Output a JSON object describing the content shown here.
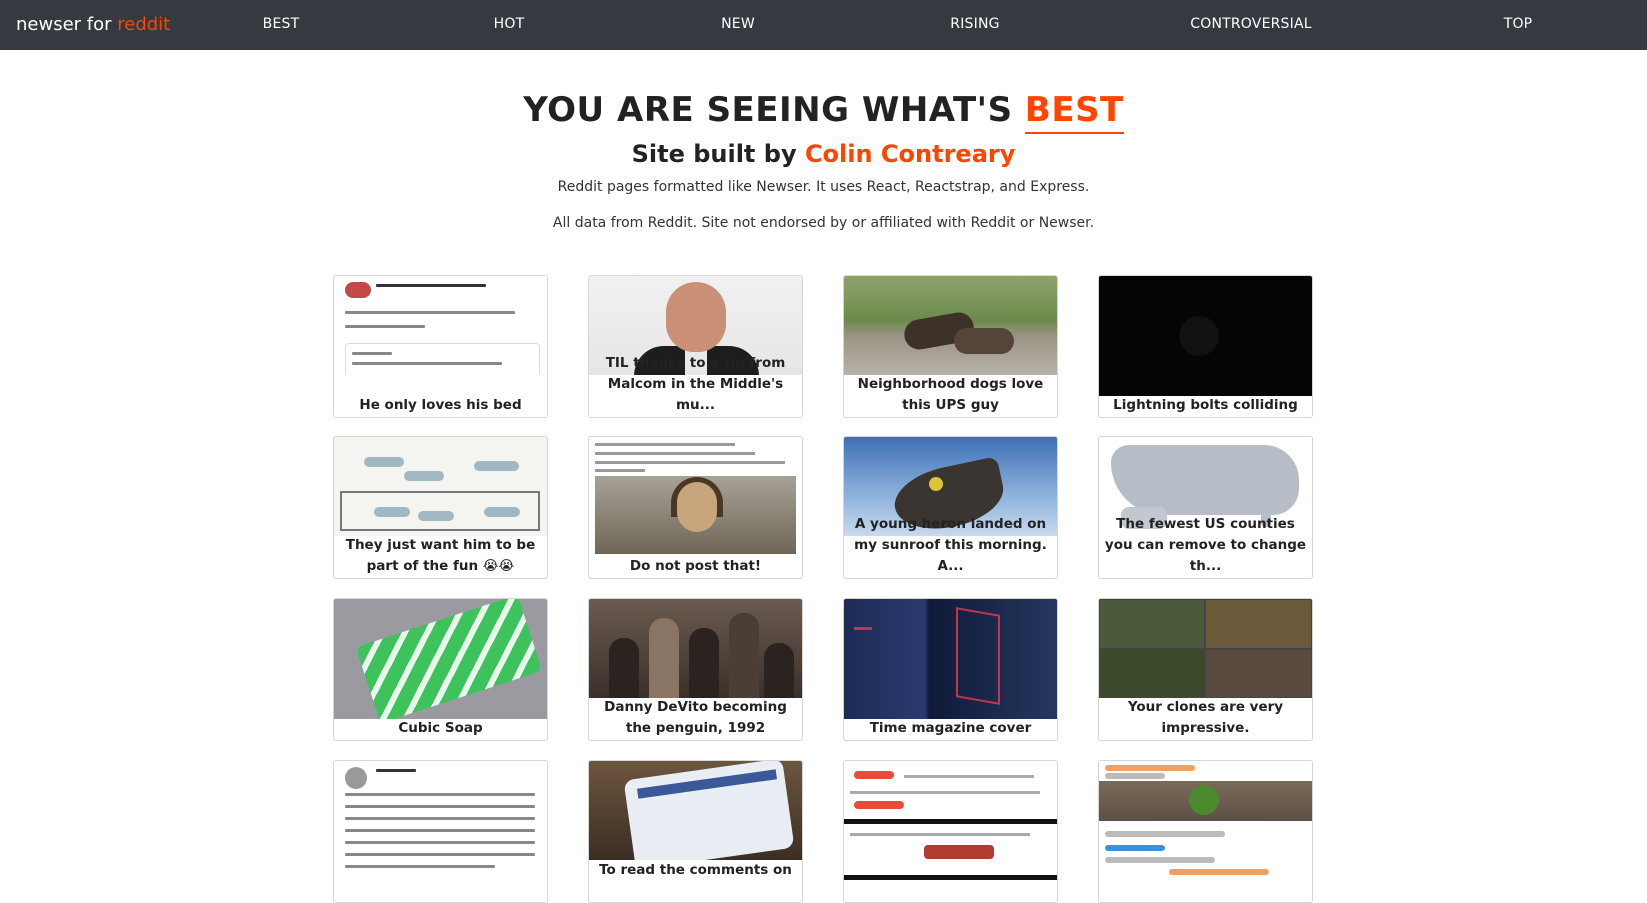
{
  "brand": {
    "prefix": "newser for ",
    "accent": "reddit"
  },
  "nav": [
    "BEST",
    "HOT",
    "NEW",
    "RISING",
    "CONTROVERSIAL",
    "TOP"
  ],
  "hero": {
    "title_prefix": "YOU ARE SEEING WHAT'S ",
    "title_highlight": "BEST",
    "subtitle_prefix": "Site built by ",
    "author": "Colin Contreary",
    "description": "Reddit pages formatted like Newser. It uses React, Reactstrap, and Express.",
    "disclaimer": "All data from Reddit. Site not endorsed by or affiliated with Reddit or Newser."
  },
  "colors": {
    "navbar": "#343a40",
    "accent": "#ff4500"
  },
  "posts": [
    {
      "caption": "He only loves his bed",
      "thumb": "tweet-screenshot"
    },
    {
      "caption": "TIL thanks to a tip from Malcom in the Middle's mu...",
      "thumb": "man-portrait"
    },
    {
      "caption": "Neighborhood dogs love this UPS guy",
      "thumb": "dogs-photo"
    },
    {
      "caption": "Lightning bolts colliding",
      "thumb": "dark-video"
    },
    {
      "caption": "They just want him to be part of the fun 😭😭",
      "thumb": "dolphin-drawing"
    },
    {
      "caption": "Do not post that!",
      "thumb": "painting-screenshot"
    },
    {
      "caption": "A young heron landed on my sunroof this morning. A...",
      "thumb": "heron-photo"
    },
    {
      "caption": "The fewest US counties you can remove to change th...",
      "thumb": "us-map"
    },
    {
      "caption": "Cubic Soap",
      "thumb": "soap-photo"
    },
    {
      "caption": "Danny DeVito becoming the penguin, 1992",
      "thumb": "movie-still"
    },
    {
      "caption": "Time magazine cover",
      "thumb": "time-cover"
    },
    {
      "caption": "Your clones are very impressive.",
      "thumb": "game-collage"
    },
    {
      "caption": "",
      "thumb": "tweet-screenshot"
    },
    {
      "caption": "To read the comments on",
      "thumb": "phone-photo"
    },
    {
      "caption": "",
      "thumb": "chat-screenshot"
    },
    {
      "caption": "",
      "thumb": "plant-screenshot"
    }
  ]
}
